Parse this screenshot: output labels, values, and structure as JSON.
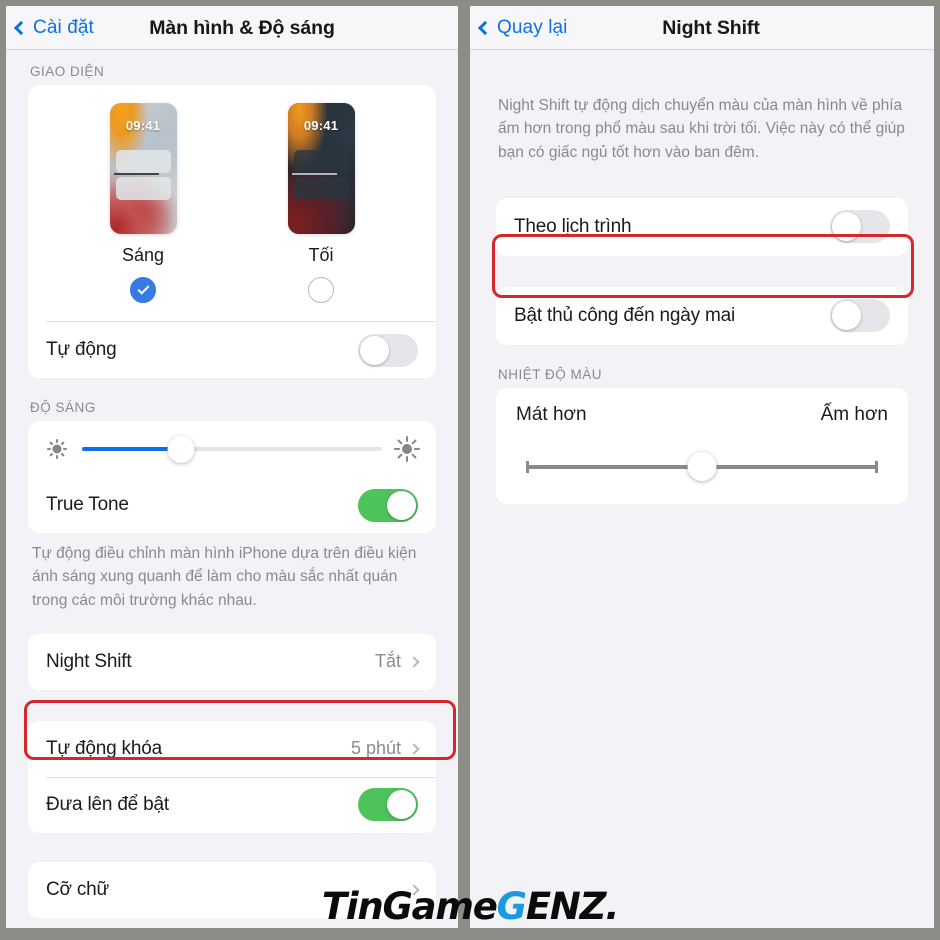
{
  "theme": {
    "accent_blue": "#0a72e8",
    "toggle_green": "#4ec35c",
    "highlight_red": "#d4282c",
    "page_bg": "#f2f2f7",
    "frame_gray": "#8d8d87",
    "watermark_blue": "#1b9ae0"
  },
  "left_panel": {
    "nav": {
      "back_label": "Cài đặt",
      "title": "Màn hình & Độ sáng"
    },
    "appearance": {
      "section_header": "GIAO DIỆN",
      "options": [
        {
          "name": "Sáng",
          "time": "09:41",
          "selected": true
        },
        {
          "name": "Tối",
          "time": "09:41",
          "selected": false
        }
      ],
      "automatic": {
        "label": "Tự động",
        "on": false
      }
    },
    "brightness": {
      "section_header": "ĐỘ SÁNG",
      "slider_value_percent": 33,
      "true_tone": {
        "label": "True Tone",
        "on": true
      },
      "footnote": "Tự động điều chỉnh màn hình iPhone dựa trên điều kiện ánh sáng xung quanh để làm cho màu sắc nhất quán trong các môi trường khác nhau."
    },
    "night_shift_row": {
      "label": "Night Shift",
      "value": "Tắt"
    },
    "lock_group": {
      "auto_lock": {
        "label": "Tự động khóa",
        "value": "5 phút"
      },
      "raise_to_wake": {
        "label": "Đưa lên để bật",
        "on": true
      }
    },
    "text_size_row": {
      "label": "Cỡ chữ"
    }
  },
  "right_panel": {
    "nav": {
      "back_label": "Quay lại",
      "title": "Night Shift"
    },
    "description": "Night Shift tự động dịch chuyển màu của màn hình về phía ấm hơn trong phổ màu sau khi trời tối. Việc này có thể giúp bạn có giấc ngủ tốt hơn vào ban đêm.",
    "schedule": {
      "label": "Theo lịch trình",
      "on": false
    },
    "manual": {
      "label": "Bật thủ công đến ngày mai",
      "on": false
    },
    "color_temperature": {
      "section_header": "NHIỆT ĐỘ MÀU",
      "cooler_label": "Mát hơn",
      "warmer_label": "Ấm hơn",
      "slider_value_percent": 50
    }
  },
  "watermark": {
    "part_a": "TinGame",
    "part_g": "G",
    "part_b": "ENZ."
  }
}
